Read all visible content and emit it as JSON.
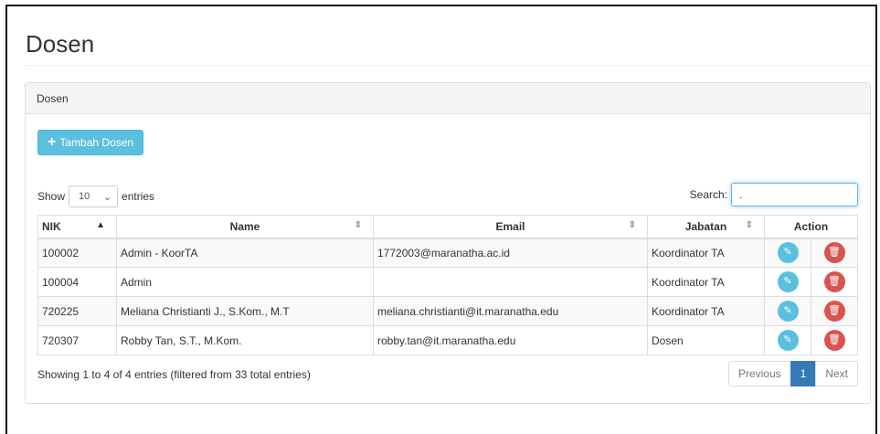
{
  "page": {
    "title": "Dosen"
  },
  "panel": {
    "heading": "Dosen",
    "add_button": "Tambah Dosen"
  },
  "controls": {
    "show_label": "Show",
    "length_value": "10",
    "entries_label": "entries",
    "search_label": "Search:",
    "search_value": "."
  },
  "table": {
    "headers": [
      "NIK",
      "Name",
      "Email",
      "Jabatan",
      "Action"
    ],
    "rows": [
      {
        "nik": "100002",
        "name": "Admin - KoorTA",
        "email": "1772003@maranatha.ac.id",
        "jabatan": "Koordinator TA"
      },
      {
        "nik": "100004",
        "name": "Admin",
        "email": "",
        "jabatan": "Koordinator TA"
      },
      {
        "nik": "720225",
        "name": "Meliana Christianti J., S.Kom., M.T",
        "email": "meliana.christianti@it.maranatha.edu",
        "jabatan": "Koordinator TA"
      },
      {
        "nik": "720307",
        "name": "Robby Tan, S.T., M.Kom.",
        "email": "robby.tan@it.maranatha.edu",
        "jabatan": "Dosen"
      }
    ]
  },
  "footer": {
    "info": "Showing 1 to 4 of 4 entries (filtered from 33 total entries)",
    "previous": "Previous",
    "page": "1",
    "next": "Next"
  },
  "icons": {
    "edit": "pencil-icon",
    "delete": "trash-icon",
    "add": "plus-icon",
    "sort": "sort-icon"
  },
  "colors": {
    "info": "#5bc0de",
    "danger": "#d9534f",
    "primary": "#337ab7"
  }
}
